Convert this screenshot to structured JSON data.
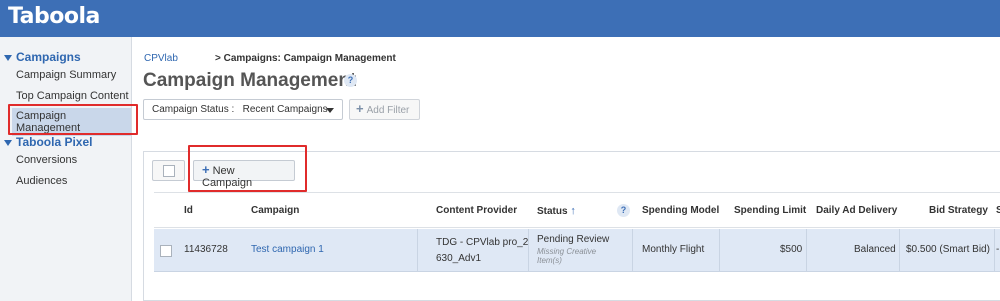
{
  "brand": {
    "logo_text": "Taboola",
    "bar_color": "#3d6fb6"
  },
  "sidebar": {
    "campaigns_section": "Campaigns",
    "items": [
      {
        "label": "Campaign Summary"
      },
      {
        "label": "Top Campaign Content"
      },
      {
        "label": "Campaign Management",
        "active": true
      }
    ],
    "pixel_section": "Taboola Pixel",
    "pixel_items": [
      {
        "label": "Conversions"
      },
      {
        "label": "Audiences"
      }
    ]
  },
  "breadcrumb": {
    "root": "CPVlab",
    "current": "> Campaigns: Campaign Management"
  },
  "page": {
    "title": "Campaign Management",
    "help_icon": "?"
  },
  "filters": {
    "status_label": "Campaign Status :",
    "status_value": "Recent Campaigns",
    "add_filter_label": "Add Filter"
  },
  "toolbar": {
    "new_campaign_label": "New Campaign"
  },
  "table": {
    "headers": {
      "id": "Id",
      "campaign": "Campaign",
      "content_provider": "Content Provider",
      "status": "Status",
      "spending_model": "Spending Model",
      "spending_limit": "Spending Limit",
      "daily_ad_delivery": "Daily Ad Delivery",
      "bid_strategy": "Bid Strategy",
      "next": "S"
    },
    "rows": [
      {
        "id": "11436728",
        "campaign": "Test campaign 1",
        "content_provider_line1": "TDG - CPVlab pro_2",
        "content_provider_line2": "630_Adv1",
        "status": "Pending Review",
        "status_note_line1": "Missing Creative",
        "status_note_line2": "Item(s)",
        "spending_model": "Monthly Flight",
        "spending_limit": "$500",
        "daily_ad_delivery": "Balanced",
        "bid_strategy": "$0.500 (Smart Bid)",
        "next": "-"
      }
    ]
  },
  "colors": {
    "accent": "#2f67b0",
    "highlight_box": "#e02b2b",
    "selected_row": "#dfe8f5"
  }
}
